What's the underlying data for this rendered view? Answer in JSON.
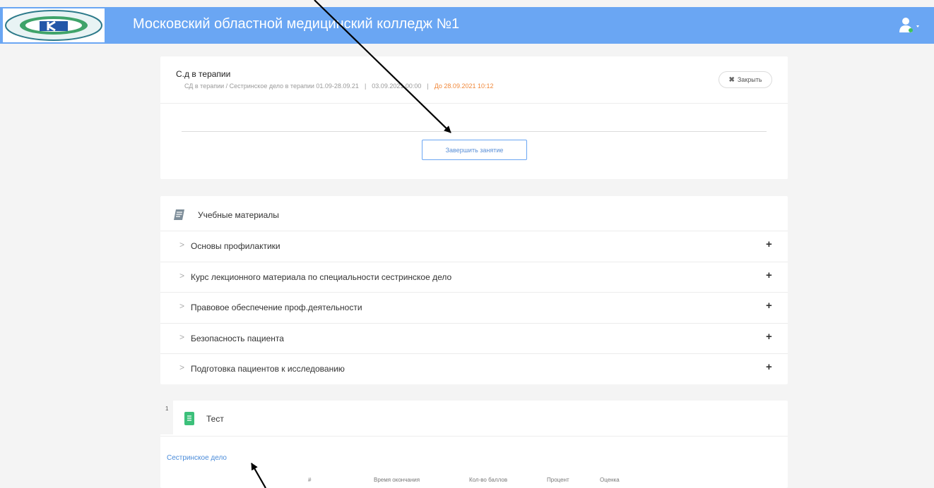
{
  "header": {
    "title": "Московский областной медицинский колледж №1",
    "logo_icon": "college-logo",
    "user_icon": "user-icon",
    "bg_color": "#6aa6f3"
  },
  "lesson": {
    "title": "С.д в терапии",
    "path": "СД в терапии / Сестринское дело в терапии 01.09-28.09.21",
    "sep1": "|",
    "start": "03.09.2021 00:00",
    "sep2": "|",
    "deadline": "До 28.09.2021 10:12",
    "close_label": "Закрыть",
    "finish_label": "Завершить занятие"
  },
  "materials": {
    "title": "Учебные материалы",
    "icon": "book-icon",
    "items": [
      {
        "label": "Основы профилактики"
      },
      {
        "label": "Курс лекционного материала по специальности сестринское дело"
      },
      {
        "label": "Правовое обеспечение проф.деятельности"
      },
      {
        "label": "Безопасность пациента"
      },
      {
        "label": "Подготовка пациентов к исследованию"
      }
    ]
  },
  "test": {
    "number": "1",
    "title": "Тест",
    "icon": "test-doc-icon",
    "link": "Сестринское дело",
    "columns": [
      "#",
      "Время окончания",
      "Кол-во баллов",
      "Процент",
      "Оценка"
    ]
  },
  "colors": {
    "accent": "#6aa6f3",
    "link": "#4a8bd9",
    "deadline": "#f0883a"
  }
}
